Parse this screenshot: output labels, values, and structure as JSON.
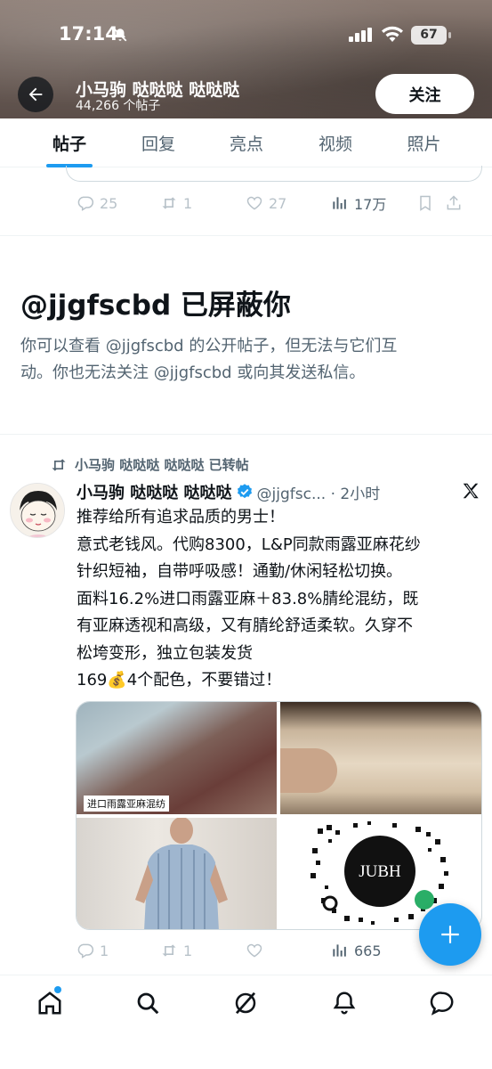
{
  "status_bar": {
    "time": "17:14",
    "battery": "67"
  },
  "header": {
    "name": "小马驹 哒哒哒 哒哒哒",
    "post_count": "44,266 个帖子",
    "follow_label": "关注"
  },
  "tabs": [
    {
      "label": "帖子",
      "active": true
    },
    {
      "label": "回复",
      "active": false
    },
    {
      "label": "亮点",
      "active": false
    },
    {
      "label": "视频",
      "active": false
    },
    {
      "label": "照片",
      "active": false
    }
  ],
  "prev_post_actions": {
    "replies": "25",
    "reposts": "1",
    "likes": "27",
    "views": "17万"
  },
  "blocked": {
    "title": "@jjgfscbd 已屏蔽你",
    "line1": "你可以查看 @jjgfscbd 的公开帖子，但无法与它们互",
    "line2": "动。你也无法关注 @jjgfscbd 或向其发送私信。"
  },
  "post": {
    "retweet_label": "小马驹 哒哒哒 哒哒哒 已转帖",
    "author_name": "小马驹 哒哒哒 哒哒哒",
    "handle_time": "@jjgfsc... · 2小时",
    "text_lines": [
      "推荐给所有追求品质的男士！",
      "意式老钱风。代购8300，L&P同款雨露亚麻花纱",
      "针织短袖，自带呼吸感！通勤/休闲轻松切换。",
      "面料16.2%进口雨露亚麻＋83.8%腈纶混纺，既",
      "有亚麻透视和高级，又有腈纶舒适柔软。久穿不",
      "松垮变形，独立包装发货",
      "169💰4个配色，不要错过！"
    ],
    "media_label": "进口雨露亚麻混纺",
    "qr_brand": "JUBH",
    "actions": {
      "replies": "1",
      "reposts": "1",
      "likes": "",
      "views": "665"
    }
  },
  "colors": {
    "accent": "#1d9bf0",
    "text": "#0f1419",
    "muted": "#536471"
  },
  "icons": [
    "back-arrow-icon",
    "bell-off-icon",
    "reply-icon",
    "repost-icon",
    "like-icon",
    "views-icon",
    "bookmark-icon",
    "share-icon",
    "verified-icon",
    "x-logo-icon",
    "compose-plus-icon",
    "home-icon",
    "search-icon",
    "grok-icon",
    "notifications-icon",
    "messages-icon"
  ]
}
